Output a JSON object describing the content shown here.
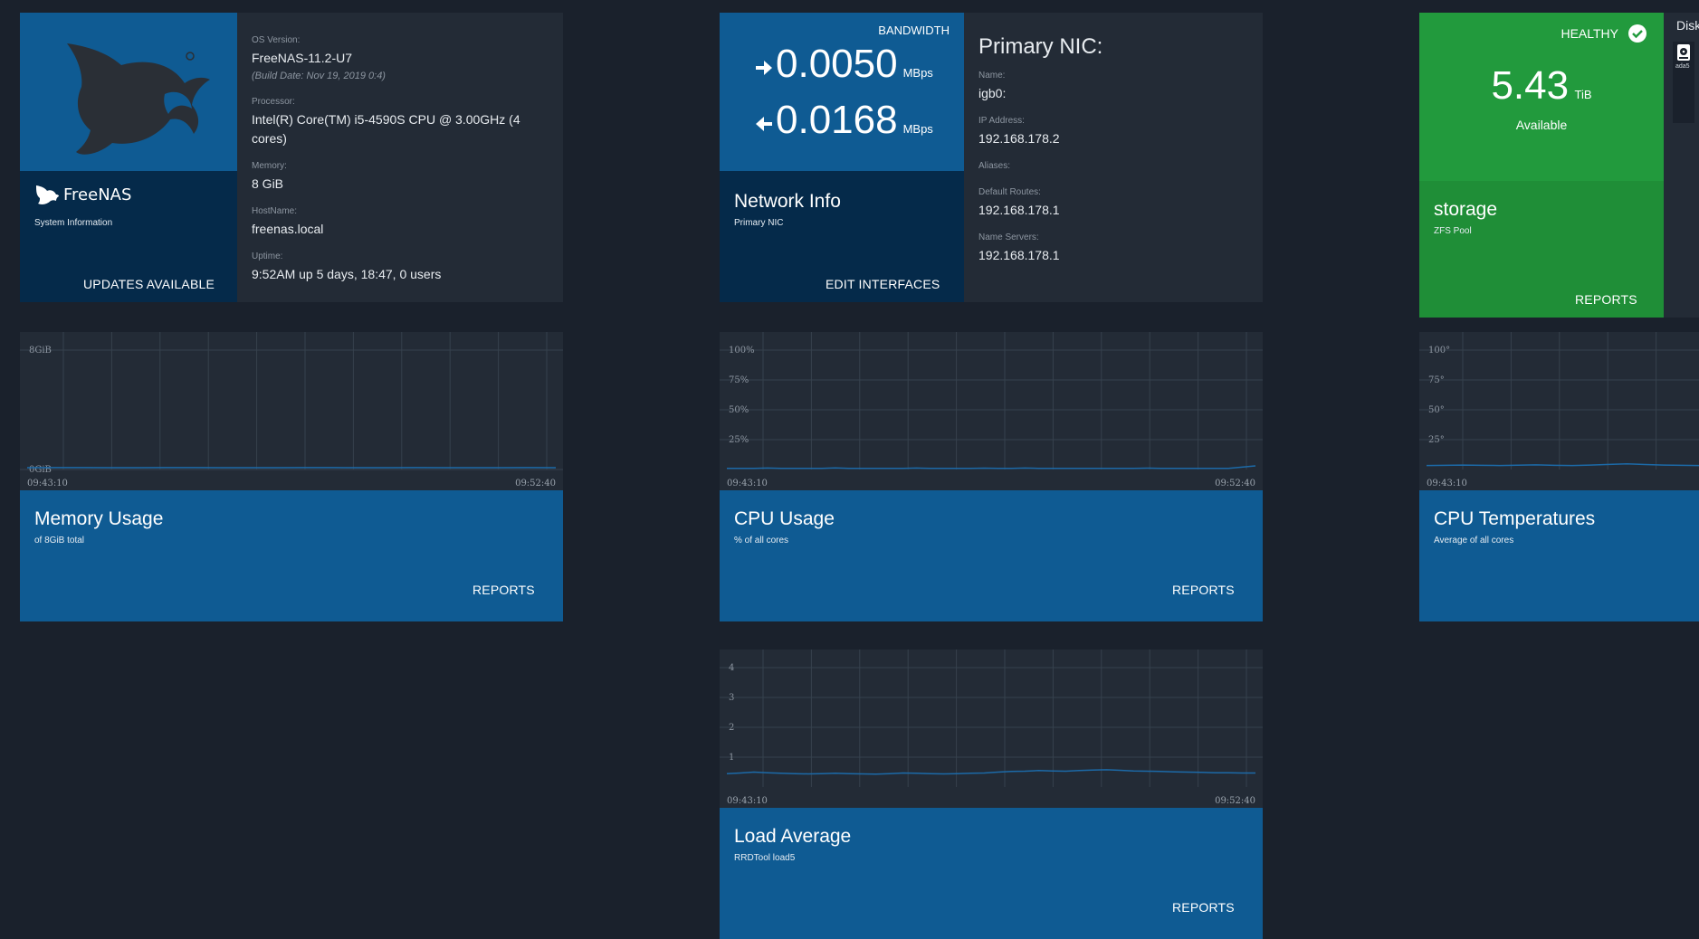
{
  "colors": {
    "background": "#1a212c",
    "card": "#232b36",
    "primary": "#0f5b93",
    "primary_dark": "#052a4a",
    "healthy": "#229a3d",
    "grid": "#36414d",
    "line": "#1c6aa8"
  },
  "sysinfo": {
    "brand": "FreeNAS",
    "subtitle": "System Information",
    "action": "UPDATES AVAILABLE",
    "os_label": "OS Version:",
    "os_value": "FreeNAS-11.2-U7",
    "build_date": "(Build Date: Nov 19, 2019 0:4)",
    "processor_label": "Processor:",
    "processor_value_1": "Intel(R) Core(TM) i5-4590S CPU @ 3.00GHz (4",
    "processor_value_2": "cores)",
    "memory_label": "Memory:",
    "memory_value": "8 GiB",
    "hostname_label": "HostName:",
    "hostname_value": "freenas.local",
    "uptime_label": "Uptime:",
    "uptime_value": "9:52AM up 5 days, 18:47, 0 users"
  },
  "network": {
    "bandwidth_label": "BANDWIDTH",
    "out_value": "0.0050",
    "out_unit": "MBps",
    "in_value": "0.0168",
    "in_unit": "MBps",
    "title": "Network Info",
    "subtitle": "Primary NIC",
    "action": "EDIT INTERFACES",
    "nic_heading": "Primary NIC:",
    "name_label": "Name:",
    "name_value": "igb0:",
    "ip_label": "IP Address:",
    "ip_value": "192.168.178.2",
    "aliases_label": "Aliases:",
    "routes_label": "Default Routes:",
    "routes_value": "192.168.178.1",
    "ns_label": "Name Servers:",
    "ns_value": "192.168.178.1"
  },
  "pool": {
    "status": "HEALTHY",
    "size_value": "5.43",
    "size_unit": "TiB",
    "available_label": "Available",
    "name": "storage",
    "type": "ZFS Pool",
    "action": "REPORTS",
    "disks_label": "Disks",
    "disk_name": "ada5"
  },
  "memory_widget": {
    "title": "Memory Usage",
    "subtitle": "of 8GiB total",
    "action": "REPORTS",
    "time_start": "09:43:10",
    "time_end": "09:52:40"
  },
  "cpu_widget": {
    "title": "CPU Usage",
    "subtitle": "% of all cores",
    "action": "REPORTS",
    "time_start": "09:43:10",
    "time_end": "09:52:40"
  },
  "temp_widget": {
    "title": "CPU Temperatures",
    "subtitle": "Average of all cores",
    "time_start": "09:43:10"
  },
  "load_widget": {
    "title": "Load Average",
    "subtitle": "RRDTool load5",
    "action": "REPORTS",
    "time_start": "09:43:10",
    "time_end": "09:52:40"
  },
  "chart_data": [
    {
      "id": "memory",
      "type": "line",
      "x": [
        "09:43:10",
        "09:52:40"
      ],
      "ylim": [
        0,
        8
      ],
      "yticks": [
        "8GiB",
        "0GiB"
      ],
      "series": [
        {
          "values": [
            0.12,
            0.13,
            0.13,
            0.12,
            0.12,
            0.13,
            0.13,
            0.12,
            0.12,
            0.12,
            0.13,
            0.13,
            0.12,
            0.12,
            0.13,
            0.12,
            0.12,
            0.12,
            0.13,
            0.12
          ]
        }
      ]
    },
    {
      "id": "cpu",
      "type": "line",
      "x": [
        "09:43:10",
        "09:52:40"
      ],
      "ylim": [
        0,
        100
      ],
      "yticks": [
        "100%",
        "75%",
        "50%",
        "25%"
      ],
      "series": [
        {
          "values": [
            1,
            1,
            1,
            1.2,
            1,
            1,
            1,
            1,
            1.3,
            1,
            1,
            1,
            1,
            1,
            1.2,
            1,
            1,
            1,
            1,
            1.1,
            1,
            1,
            1.2,
            1,
            1,
            1,
            1,
            1,
            1,
            1,
            1,
            1.1,
            1,
            1,
            1,
            1,
            1,
            1,
            2,
            3
          ]
        }
      ]
    },
    {
      "id": "temp",
      "type": "line",
      "x": [
        "09:43:10"
      ],
      "ylim": [
        25,
        100
      ],
      "yticks": [
        "100°",
        "75°",
        "50°",
        "25°"
      ],
      "series": [
        {
          "values": [
            27.5,
            27.6,
            27.8,
            27.6,
            27.5,
            27.7,
            27.9,
            27.6,
            27.5,
            27.8,
            28.2,
            28.5,
            28.1,
            27.8,
            27.6,
            27.5,
            27.7,
            27.9,
            27.6,
            27.5,
            27.6,
            27.8,
            28.3,
            28.0,
            27.7,
            27.5,
            27.6,
            27.8,
            27.9,
            28.1
          ]
        }
      ]
    },
    {
      "id": "load",
      "type": "line",
      "x": [
        "09:43:10",
        "09:52:40"
      ],
      "ylim": [
        0,
        4
      ],
      "yticks": [
        "4",
        "3",
        "2",
        "1"
      ],
      "series": [
        {
          "values": [
            0.45,
            0.47,
            0.5,
            0.48,
            0.46,
            0.45,
            0.44,
            0.45,
            0.46,
            0.45,
            0.44,
            0.43,
            0.45,
            0.47,
            0.46,
            0.45,
            0.44,
            0.45,
            0.46,
            0.47,
            0.5,
            0.52,
            0.53,
            0.55,
            0.54,
            0.53,
            0.55,
            0.57,
            0.58,
            0.56,
            0.54,
            0.53,
            0.52,
            0.51,
            0.5,
            0.49,
            0.48,
            0.48,
            0.47,
            0.47
          ]
        }
      ]
    }
  ]
}
